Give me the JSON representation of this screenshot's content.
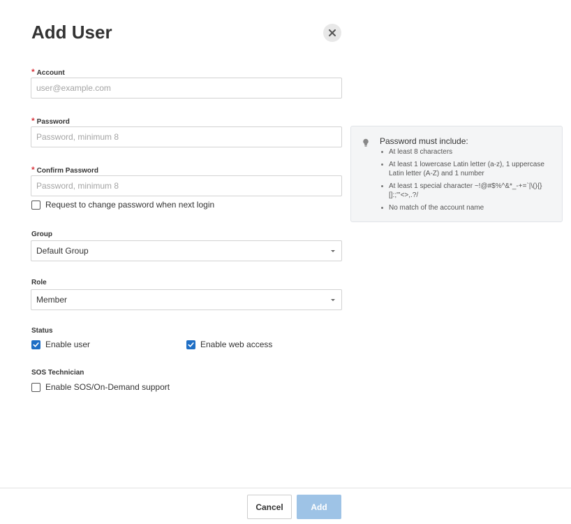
{
  "dialog": {
    "title": "Add User"
  },
  "account": {
    "label": "Account",
    "placeholder": "user@example.com",
    "value": ""
  },
  "password": {
    "label": "Password",
    "placeholder": "Password, minimum 8",
    "value": ""
  },
  "confirm_password": {
    "label": "Confirm Password",
    "placeholder": "Password, minimum 8",
    "value": ""
  },
  "change_password": {
    "label": "Request to change password when next login",
    "checked": false
  },
  "group": {
    "label": "Group",
    "selected": "Default Group"
  },
  "role": {
    "label": "Role",
    "selected": "Member"
  },
  "status": {
    "label": "Status",
    "enable_user": {
      "label": "Enable user",
      "checked": true
    },
    "enable_web_access": {
      "label": "Enable web access",
      "checked": true
    }
  },
  "sos": {
    "label": "SOS Technician",
    "enable_sos": {
      "label": "Enable SOS/On-Demand support",
      "checked": false
    }
  },
  "password_hint": {
    "title": "Password must include:",
    "items": [
      "At least 8 characters",
      "At least 1 lowercase Latin letter (a-z), 1 uppercase Latin letter (A-Z) and 1 number",
      "At least 1 special character ~!@#$%^&*_-+=`|\\(){}[]:;\"'<>,.?/",
      "No match of the account name"
    ]
  },
  "footer": {
    "cancel_label": "Cancel",
    "add_label": "Add"
  },
  "colors": {
    "accent": "#1f6fc5",
    "add_button_disabled": "#9ec3e6",
    "required_star": "#d9363e"
  },
  "icons": {
    "close": "close-icon",
    "hint": "lightbulb-icon",
    "check": "checkmark-icon",
    "dropdown": "caret-down-icon"
  }
}
